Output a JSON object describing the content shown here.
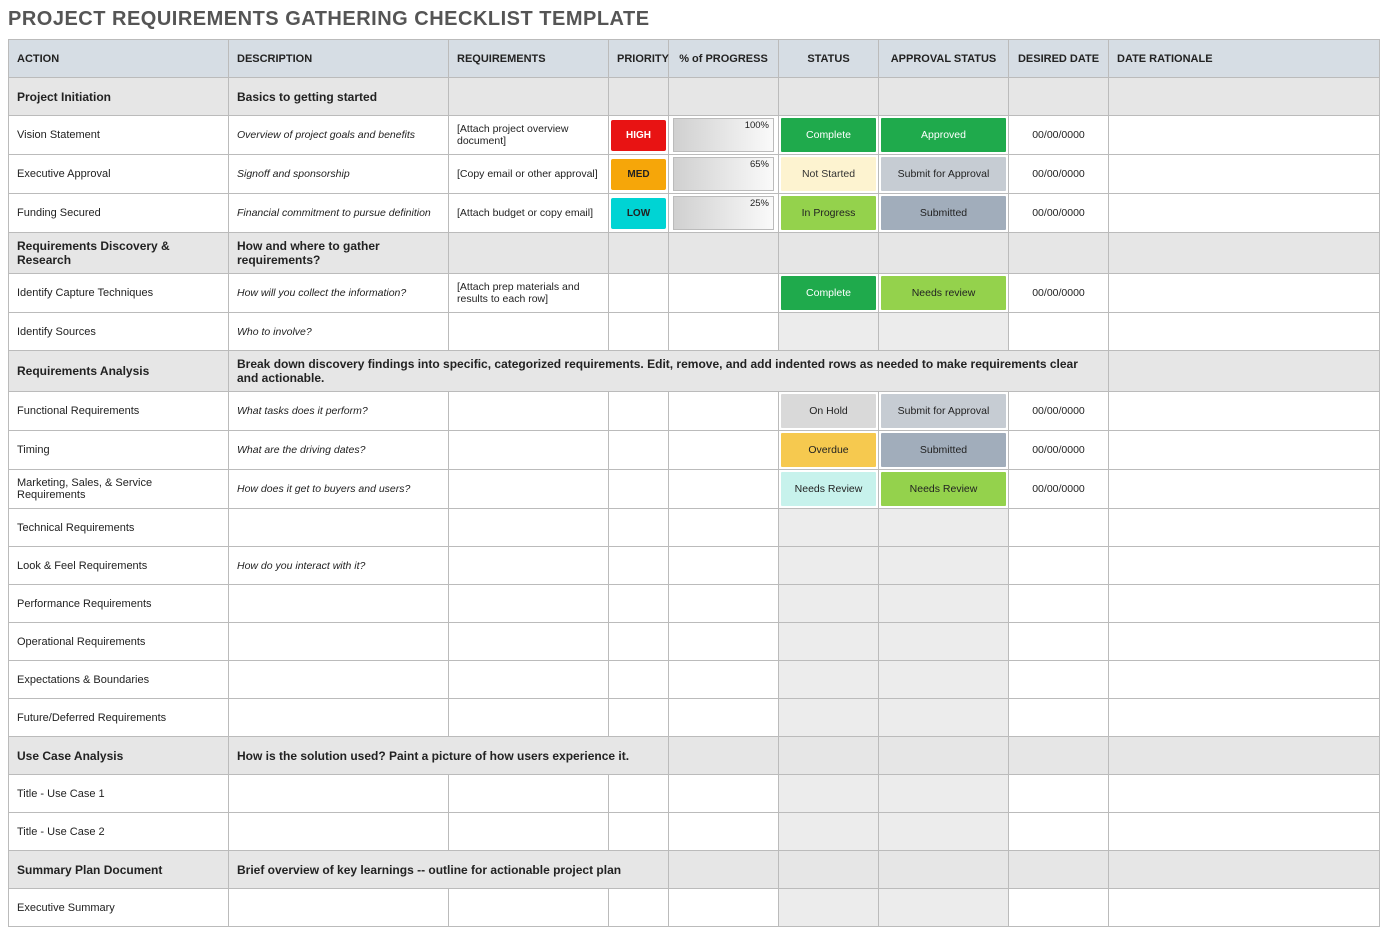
{
  "title": "PROJECT REQUIREMENTS GATHERING CHECKLIST TEMPLATE",
  "columns": {
    "action": "ACTION",
    "description": "DESCRIPTION",
    "requirements": "REQUIREMENTS",
    "priority": "PRIORITY",
    "progress": "% of PROGRESS",
    "status": "STATUS",
    "approval": "APPROVAL STATUS",
    "date": "DESIRED DATE",
    "rationale": "DATE RATIONALE"
  },
  "sections": {
    "initiation": {
      "title": "Project Initiation",
      "desc": "Basics to getting started"
    },
    "discovery": {
      "title": "Requirements Discovery & Research",
      "desc": "How and where to gather requirements?"
    },
    "analysis": {
      "title": "Requirements Analysis",
      "desc": "Break down discovery findings into specific, categorized requirements. Edit, remove, and add indented rows as needed to make requirements clear and actionable."
    },
    "usecase": {
      "title": "Use Case Analysis",
      "desc": "How is the solution used? Paint a picture of how users experience it."
    },
    "summary": {
      "title": "Summary Plan Document",
      "desc": "Brief overview of key learnings -- outline for actionable project plan"
    }
  },
  "rows": {
    "vision": {
      "action": "Vision Statement",
      "desc": "Overview of project goals and benefits",
      "req": "[Attach project overview document]",
      "priority": "HIGH",
      "progress": "100%",
      "status": "Complete",
      "approval": "Approved",
      "date": "00/00/0000"
    },
    "exec": {
      "action": "Executive Approval",
      "desc": "Signoff and sponsorship",
      "req": "[Copy email or other approval]",
      "priority": "MED",
      "progress": "65%",
      "status": "Not Started",
      "approval": "Submit for Approval",
      "date": "00/00/0000"
    },
    "funding": {
      "action": "Funding Secured",
      "desc": "Financial commitment to pursue definition",
      "req": "[Attach budget or copy email]",
      "priority": "LOW",
      "progress": "25%",
      "status": "In Progress",
      "approval": "Submitted",
      "date": "00/00/0000"
    },
    "capture": {
      "action": "Identify Capture Techniques",
      "desc": "How will you collect the information?",
      "req": "[Attach prep materials and results to each row]",
      "status": "Complete",
      "approval": "Needs review",
      "date": "00/00/0000"
    },
    "sources": {
      "action": "Identify Sources",
      "desc": "Who to involve?"
    },
    "functional": {
      "action": "Functional Requirements",
      "desc": "What tasks does it perform?",
      "status": "On Hold",
      "approval": "Submit for Approval",
      "date": "00/00/0000"
    },
    "timing": {
      "action": "Timing",
      "desc": "What are the driving dates?",
      "status": "Overdue",
      "approval": "Submitted",
      "date": "00/00/0000"
    },
    "marketing": {
      "action": "Marketing, Sales, & Service Requirements",
      "desc": "How does it get to buyers and users?",
      "status": "Needs Review",
      "approval": "Needs Review",
      "date": "00/00/0000"
    },
    "technical": {
      "action": "Technical Requirements"
    },
    "lookfeel": {
      "action": "Look & Feel Requirements",
      "desc": "How do you interact with it?"
    },
    "performance": {
      "action": "Performance Requirements"
    },
    "operational": {
      "action": "Operational Requirements"
    },
    "expectations": {
      "action": "Expectations & Boundaries"
    },
    "future": {
      "action": "Future/Deferred Requirements"
    },
    "uc1": {
      "action": "Title - Use Case 1"
    },
    "uc2": {
      "action": "Title - Use Case 2"
    },
    "execsum": {
      "action": "Executive Summary"
    }
  }
}
